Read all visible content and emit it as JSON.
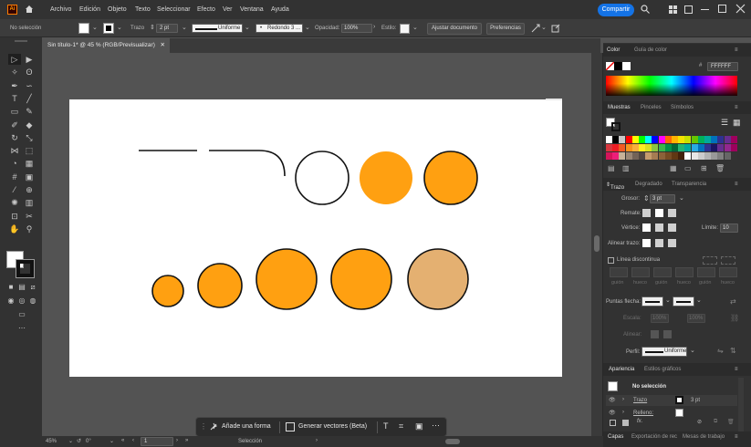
{
  "menu": {
    "items": [
      "Archivo",
      "Edición",
      "Objeto",
      "Texto",
      "Seleccionar",
      "Efecto",
      "Ver",
      "Ventana",
      "Ayuda"
    ],
    "share": "Compartir"
  },
  "options": {
    "selection": "No selección",
    "stroke_label": "Trazo",
    "stroke_value": "2 pt",
    "stroke_style": "Uniforme",
    "brush": "Redondo 3 ...",
    "opacity_label": "Opacidad:",
    "opacity_value": "100%",
    "style_label": "Estilo:",
    "fit_doc": "Ajustar documento",
    "prefs": "Preferencias"
  },
  "document": {
    "tab": "Sin título-1* @ 45 % (RGB/Previsualizar)"
  },
  "status": {
    "zoom": "45%",
    "rotation": "0°",
    "artboard": "1",
    "mode": "Selección"
  },
  "contextbar": {
    "add_shape": "Añade una forma",
    "gen_vectors": "Generar vectores (Beta)"
  },
  "color_panel": {
    "tab1": "Color",
    "tab2": "Guía de color",
    "hex": "FFFFFF"
  },
  "swatch_panel": {
    "tab1": "Muestras",
    "tab2": "Pinceles",
    "tab3": "Símbolos"
  },
  "stroke_panel": {
    "tab1": "Trazo",
    "tab2": "Degradado",
    "tab3": "Transparencia",
    "weight_label": "Grosor:",
    "weight_value": "3 pt",
    "cap_label": "Remate:",
    "corner_label": "Vértice:",
    "limit_label": "Límite:",
    "limit_value": "10",
    "align_label": "Alinear trazo:",
    "dashed_label": "Línea discontinua",
    "dash_cells": [
      "guión",
      "hueco",
      "guión",
      "hueco",
      "guión",
      "hueco"
    ],
    "arrow_label": "Puntas flecha:",
    "scale_label": "Escala:",
    "scale1": "100%",
    "scale2": "100%",
    "align2_label": "Alinear:",
    "profile_label": "Perfil:",
    "profile_value": "Uniforme"
  },
  "appearance_panel": {
    "tab1": "Apariencia",
    "tab2": "Estilos gráficos",
    "no_selection": "No selección",
    "stroke_row": "Trazo",
    "stroke_row_value": "3 pt",
    "fill_row": "Relleno:",
    "fx": "fx."
  },
  "bottom_tabs": {
    "tab1": "Capas",
    "tab2": "Exportación de rec",
    "tab3": "Mesas de trabajo"
  },
  "colors": {
    "orange": "#ffa011",
    "tan": "#e4b071",
    "accent": "#1473e6"
  },
  "swatch_rows": [
    [
      "#ffffff",
      "#000000",
      "#c8c8c8",
      "#ff0000",
      "#ffff00",
      "#00ff00",
      "#00ffff",
      "#0000ff",
      "#ff00ff",
      "#ff6a00",
      "#ffb400",
      "#f4e300",
      "#c8e100",
      "#66c600",
      "#00b15a",
      "#00a99d",
      "#0071bc",
      "#2e3192",
      "#662d91",
      "#9e005d"
    ],
    [
      "#d7373f",
      "#ed1c24",
      "#f15a24",
      "#f7931e",
      "#fbb03b",
      "#fcee21",
      "#d9e021",
      "#8cc63f",
      "#39b54a",
      "#009245",
      "#006837",
      "#22b573",
      "#00a99d",
      "#29abe2",
      "#0071bc",
      "#2e3192",
      "#1b1464",
      "#662d91",
      "#93278f",
      "#9e005d"
    ],
    [
      "#d4145a",
      "#ed1e79",
      "#c7b299",
      "#998675",
      "#736357",
      "#534741",
      "#c69c6d",
      "#a67c52",
      "#8c6239",
      "#754c24",
      "#603813",
      "#42210b",
      "#ffffff",
      "#e6e6e6",
      "#cccccc",
      "#b3b3b3",
      "#999999",
      "#808080",
      "#666666",
      "#333333"
    ]
  ]
}
